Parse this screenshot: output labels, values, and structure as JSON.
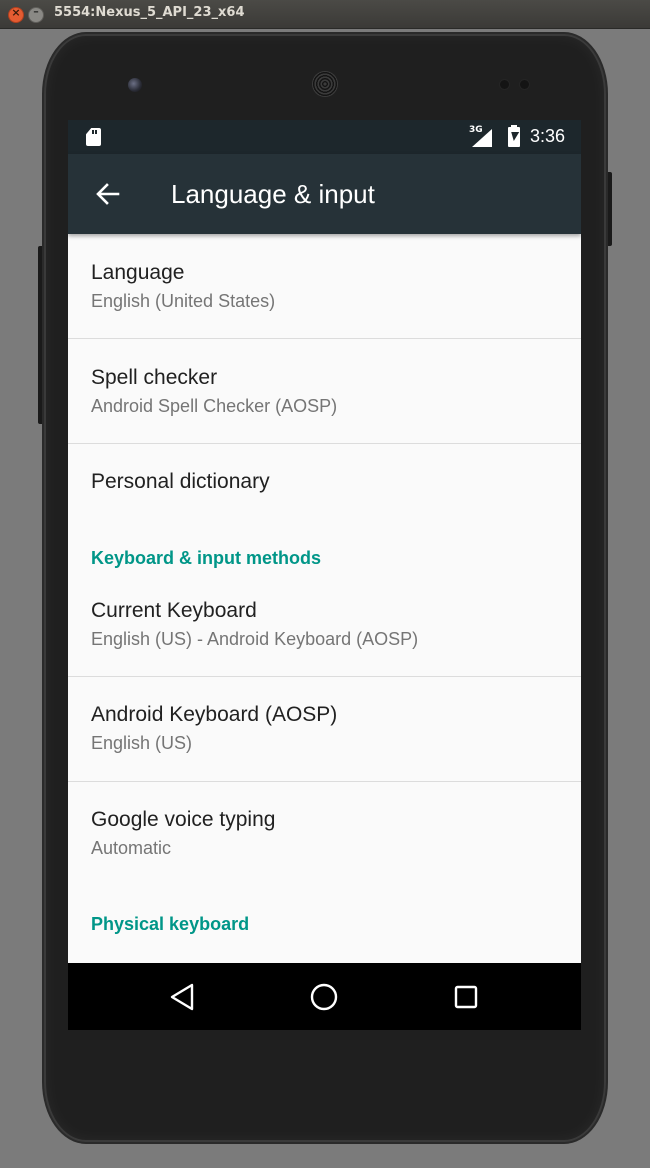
{
  "window": {
    "title": "5554:Nexus_5_API_23_x64",
    "close_glyph": "×",
    "minimize_glyph": "–"
  },
  "statusbar": {
    "network": "3G",
    "time": "3:36",
    "icons": [
      "sd-card-icon",
      "signal-icon",
      "battery-charging-icon"
    ]
  },
  "appbar": {
    "title": "Language & input",
    "nav_icon": "back-arrow-icon"
  },
  "settings": {
    "language": {
      "title": "Language",
      "summary": "English (United States)"
    },
    "spell_checker": {
      "title": "Spell checker",
      "summary": "Android Spell Checker (AOSP)"
    },
    "personal_dictionary": {
      "title": "Personal dictionary"
    },
    "keyboard_category": "Keyboard & input methods",
    "current_keyboard": {
      "title": "Current Keyboard",
      "summary": "English (US) - Android Keyboard (AOSP)"
    },
    "android_keyboard": {
      "title": "Android Keyboard (AOSP)",
      "summary": "English (US)"
    },
    "google_voice": {
      "title": "Google voice typing",
      "summary": "Automatic"
    },
    "physical_category": "Physical keyboard"
  },
  "colors": {
    "statusbar": "#1d272c",
    "appbar": "#263238",
    "accent": "#009688",
    "background": "#fafafa"
  },
  "navbar": {
    "icons": [
      "back-triangle-icon",
      "home-circle-icon",
      "recents-square-icon"
    ]
  }
}
